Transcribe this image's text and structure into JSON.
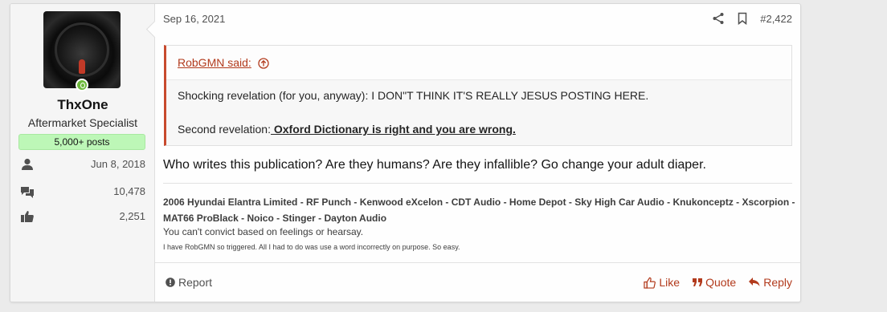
{
  "user": {
    "name": "ThxOne",
    "title": "Aftermarket Specialist",
    "posts_badge": "5,000+ posts",
    "stats": [
      {
        "icon": "user-icon",
        "value": "Jun 8, 2018"
      },
      {
        "icon": "messages-icon",
        "value": "10,478"
      },
      {
        "icon": "thumbs-up-icon",
        "value": "2,251"
      }
    ]
  },
  "post": {
    "date": "Sep 16, 2021",
    "number": "#2,422",
    "quote": {
      "author": "RobGMN said:",
      "line1": "Shocking revelation (for you, anyway): I DON\"T THINK IT'S REALLY JESUS POSTING HERE.",
      "line2_prefix": "Second revelation:",
      "line2_link": " Oxford Dictionary is right and you are wrong."
    },
    "message": "Who writes this publication? Are they humans? Are they infallible? Go change your adult diaper.",
    "signature": {
      "line1": "2006 Hyundai Elantra Limited - RF Punch - Kenwood eXcelon - CDT Audio - Home Depot - Sky High Car Audio - Knukonceptz - Xscorpion - MAT66 ProBlack - Noico - Stinger - Dayton Audio",
      "line2": "You can't convict based on feelings or hearsay.",
      "line3": "I have RobGMN so triggered. All I had to do was use a word incorrectly on purpose. So easy."
    }
  },
  "footer": {
    "report": "Report",
    "like": "Like",
    "quote": "Quote",
    "reply": "Reply"
  },
  "colors": {
    "accent": "#b23a1c",
    "badge_bg": "#bdf7b7",
    "online": "#6db83c"
  }
}
